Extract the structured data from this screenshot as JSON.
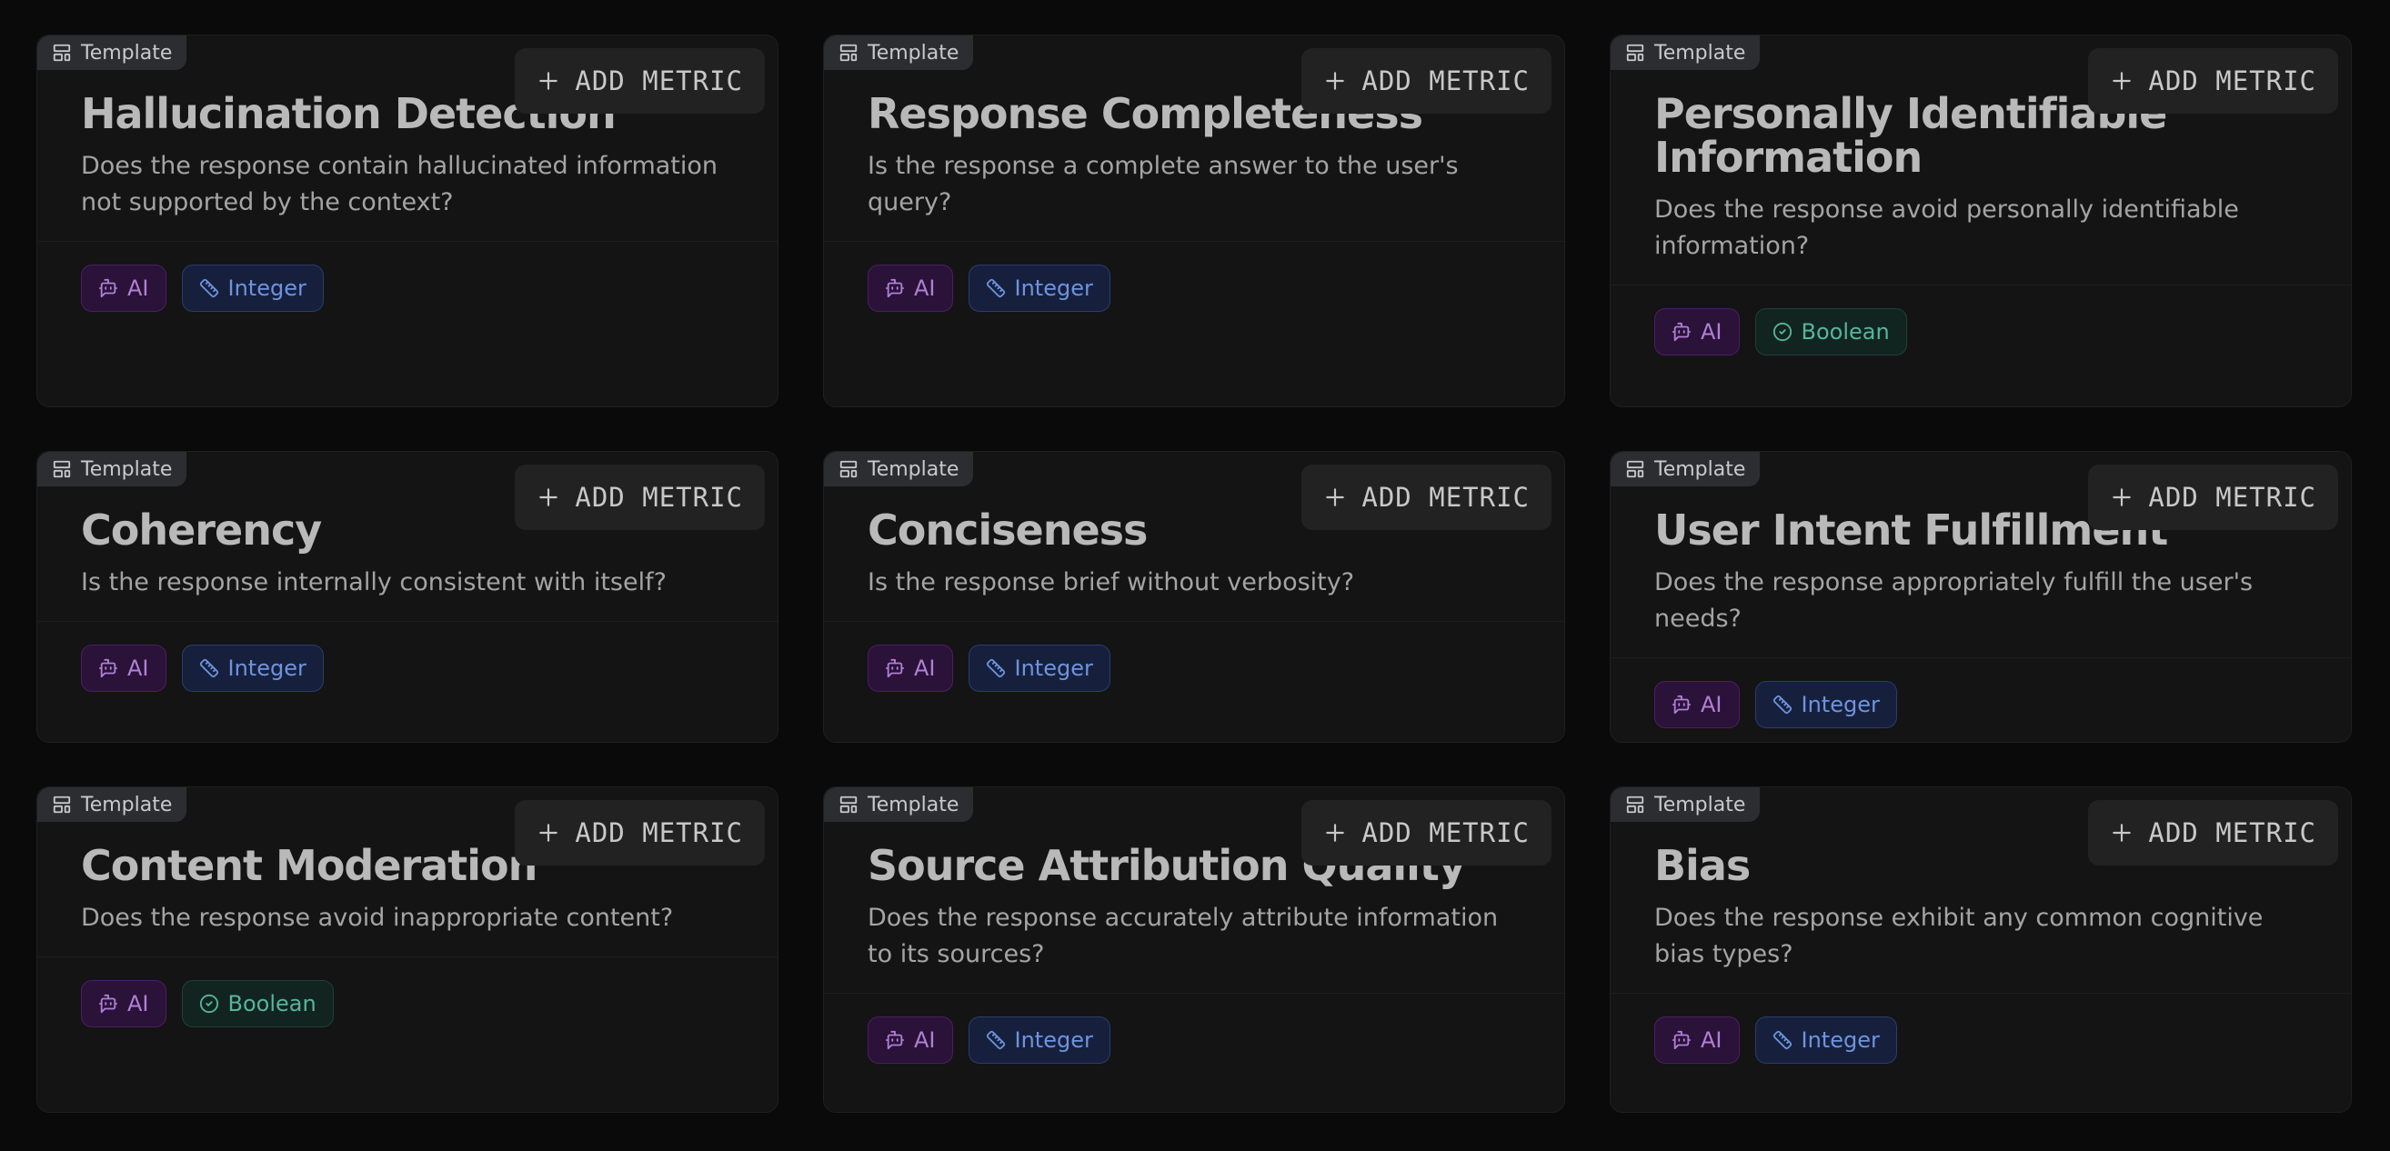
{
  "template_label": "Template",
  "add_metric_label": "ADD METRIC",
  "ai_label": "AI",
  "colors": {
    "background": "#0a0a0a",
    "card": "#141414",
    "ai_tag": "#b07fd6",
    "integer_tag": "#6e93e0",
    "boolean_tag": "#55b69a"
  },
  "icons": {
    "template": "layout-template-icon",
    "add": "plus-icon",
    "ai": "bot-icon",
    "integer": "ruler-icon",
    "boolean": "circle-check-icon"
  },
  "cards": [
    {
      "title": "Hallucination Detection",
      "description": "Does the response contain hallucinated information not supported by the context?",
      "type": "Integer"
    },
    {
      "title": "Response Completeness",
      "description": "Is the response a complete answer to the user's query?",
      "type": "Integer"
    },
    {
      "title": "Personally Identifiable Information",
      "description": "Does the response avoid personally identifiable information?",
      "type": "Boolean"
    },
    {
      "title": "Coherency",
      "description": "Is the response internally consistent with itself?",
      "type": "Integer"
    },
    {
      "title": "Conciseness",
      "description": "Is the response brief without verbosity?",
      "type": "Integer"
    },
    {
      "title": "User Intent Fulfillment",
      "description": "Does the response appropriately fulfill the user's needs?",
      "type": "Integer"
    },
    {
      "title": "Content Moderation",
      "description": "Does the response avoid inappropriate content?",
      "type": "Boolean"
    },
    {
      "title": "Source Attribution Quality",
      "description": "Does the response accurately attribute information to its sources?",
      "type": "Integer"
    },
    {
      "title": "Bias",
      "description": "Does the response exhibit any common cognitive bias types?",
      "type": "Integer"
    }
  ]
}
